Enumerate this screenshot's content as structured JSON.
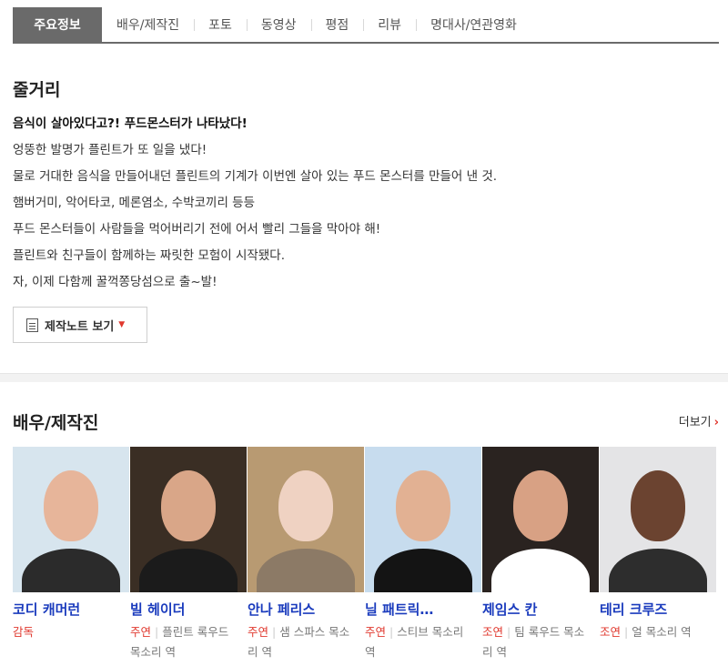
{
  "tabs": [
    {
      "label": "주요정보",
      "active": true
    },
    {
      "label": "배우/제작진"
    },
    {
      "label": "포토"
    },
    {
      "label": "동영상"
    },
    {
      "label": "평점"
    },
    {
      "label": "리뷰"
    },
    {
      "label": "명대사/연관영화"
    }
  ],
  "synopsis": {
    "title": "줄거리",
    "lines": [
      "음식이 살아있다고?! 푸드몬스터가 나타났다!",
      "엉뚱한 발명가 플린트가 또 일을 냈다!",
      " 물로 거대한 음식을 만들어내던 플린트의 기계가 이번엔 살아 있는 푸드 몬스터를 만들어 낸 것.",
      " 햄버거미, 악어타코, 메론염소, 수박코끼리 등등",
      " 푸드 몬스터들이 사람들을 먹어버리기 전에 어서 빨리 그들을 막아야 해!",
      " 플린트와 친구들이 함께하는 짜릿한 모험이 시작됐다.",
      " 자, 이제 다함께 꿀꺽쫑당섬으로 출~발!"
    ],
    "note_button": "제작노트 보기"
  },
  "cast_section": {
    "title": "배우/제작진",
    "more": "더보기",
    "members": [
      {
        "name": "코디 캐머런",
        "kind": "감독",
        "role": "",
        "bg": "#d7e5ee",
        "skin": "#e7b59a",
        "clothes": "#2b2b2b"
      },
      {
        "name": "빌 헤이더",
        "kind": "주연",
        "role": "플린트 록우드 목소리 역",
        "bg": "#3a2e24",
        "skin": "#d9a688",
        "clothes": "#1b1b1b"
      },
      {
        "name": "안나 페리스",
        "kind": "주연",
        "role": "샘 스파스 목소리 역",
        "bg": "#b89a72",
        "skin": "#efd2c2",
        "clothes": "#8c7a66"
      },
      {
        "name": "닐 패트릭…",
        "kind": "주연",
        "role": "스티브 목소리 역",
        "bg": "#c7dcee",
        "skin": "#e2b193",
        "clothes": "#141414"
      },
      {
        "name": "제임스 칸",
        "kind": "조연",
        "role": "팀 록우드 목소리 역",
        "bg": "#2a2320",
        "skin": "#d8a184",
        "clothes": "#ffffff"
      },
      {
        "name": "테리 크루즈",
        "kind": "조연",
        "role": "얼 목소리 역",
        "bg": "#e4e4e6",
        "skin": "#6b4330",
        "clothes": "#2d2d2d"
      }
    ]
  }
}
